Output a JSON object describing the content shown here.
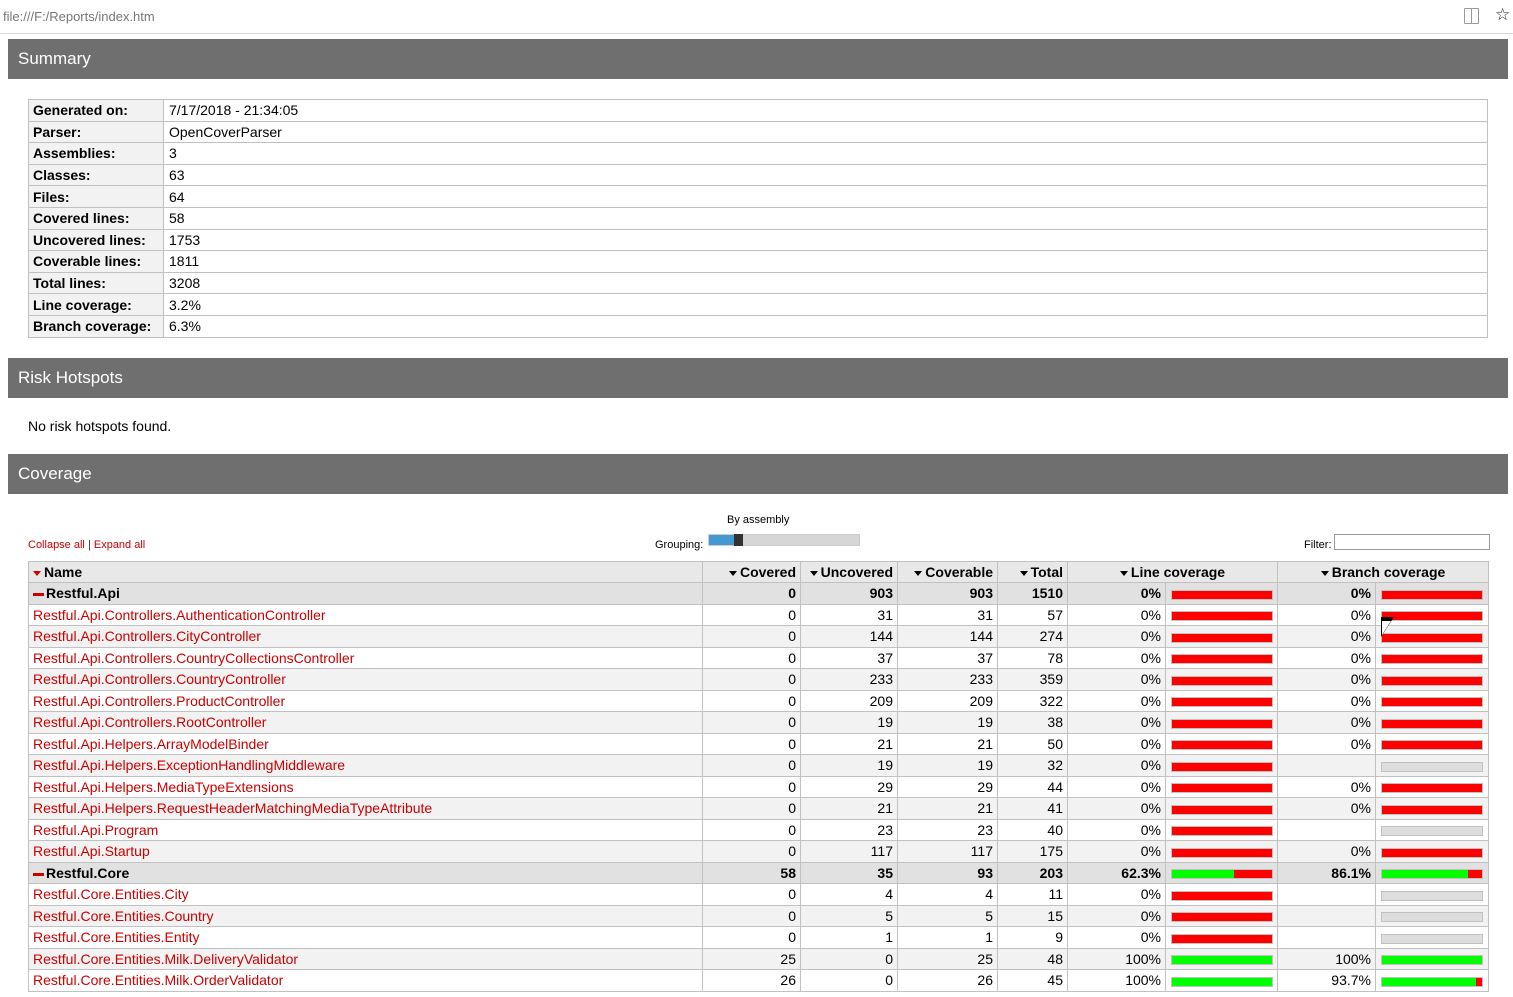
{
  "browser": {
    "url": "file:///F:/Reports/index.htm"
  },
  "summary": {
    "title": "Summary",
    "rows": [
      {
        "label": "Generated on:",
        "value": "7/17/2018 - 21:34:05"
      },
      {
        "label": "Parser:",
        "value": "OpenCoverParser"
      },
      {
        "label": "Assemblies:",
        "value": "3"
      },
      {
        "label": "Classes:",
        "value": "63"
      },
      {
        "label": "Files:",
        "value": "64"
      },
      {
        "label": "Covered lines:",
        "value": "58"
      },
      {
        "label": "Uncovered lines:",
        "value": "1753"
      },
      {
        "label": "Coverable lines:",
        "value": "1811"
      },
      {
        "label": "Total lines:",
        "value": "3208"
      },
      {
        "label": "Line coverage:",
        "value": "3.2%"
      },
      {
        "label": "Branch coverage:",
        "value": "6.3%"
      }
    ]
  },
  "risk": {
    "title": "Risk Hotspots",
    "message": "No risk hotspots found."
  },
  "coverage": {
    "title": "Coverage",
    "collapse_all": "Collapse all",
    "separator": "|",
    "expand_all": "Expand all",
    "grouping_label": "By assembly",
    "grouping_text": "Grouping:",
    "grouping_level": 0.2,
    "filter_label": "Filter:",
    "filter_value": "",
    "headers": {
      "name": "Name",
      "covered": "Covered",
      "uncovered": "Uncovered",
      "coverable": "Coverable",
      "total": "Total",
      "line_coverage": "Line coverage",
      "branch_coverage": "Branch coverage"
    },
    "colors": {
      "covered": "#00ff00",
      "uncovered": "#ff0000",
      "na": "#dddddd",
      "link": "#cc0000"
    },
    "rows": [
      {
        "type": "assembly",
        "name": "Restful.Api",
        "covered": "0",
        "uncovered": "903",
        "coverable": "903",
        "total": "1510",
        "line": "0%",
        "line_pct": 0,
        "branch": "0%",
        "branch_pct": 0
      },
      {
        "type": "class",
        "name": "Restful.Api.Controllers.AuthenticationController",
        "covered": "0",
        "uncovered": "31",
        "coverable": "31",
        "total": "57",
        "line": "0%",
        "line_pct": 0,
        "branch": "0%",
        "branch_pct": 0
      },
      {
        "type": "class",
        "name": "Restful.Api.Controllers.CityController",
        "covered": "0",
        "uncovered": "144",
        "coverable": "144",
        "total": "274",
        "line": "0%",
        "line_pct": 0,
        "branch": "0%",
        "branch_pct": 0
      },
      {
        "type": "class",
        "name": "Restful.Api.Controllers.CountryCollectionsController",
        "covered": "0",
        "uncovered": "37",
        "coverable": "37",
        "total": "78",
        "line": "0%",
        "line_pct": 0,
        "branch": "0%",
        "branch_pct": 0
      },
      {
        "type": "class",
        "name": "Restful.Api.Controllers.CountryController",
        "covered": "0",
        "uncovered": "233",
        "coverable": "233",
        "total": "359",
        "line": "0%",
        "line_pct": 0,
        "branch": "0%",
        "branch_pct": 0
      },
      {
        "type": "class",
        "name": "Restful.Api.Controllers.ProductController",
        "covered": "0",
        "uncovered": "209",
        "coverable": "209",
        "total": "322",
        "line": "0%",
        "line_pct": 0,
        "branch": "0%",
        "branch_pct": 0
      },
      {
        "type": "class",
        "name": "Restful.Api.Controllers.RootController",
        "covered": "0",
        "uncovered": "19",
        "coverable": "19",
        "total": "38",
        "line": "0%",
        "line_pct": 0,
        "branch": "0%",
        "branch_pct": 0
      },
      {
        "type": "class",
        "name": "Restful.Api.Helpers.ArrayModelBinder",
        "covered": "0",
        "uncovered": "21",
        "coverable": "21",
        "total": "50",
        "line": "0%",
        "line_pct": 0,
        "branch": "0%",
        "branch_pct": 0
      },
      {
        "type": "class",
        "name": "Restful.Api.Helpers.ExceptionHandlingMiddleware",
        "covered": "0",
        "uncovered": "19",
        "coverable": "19",
        "total": "32",
        "line": "0%",
        "line_pct": 0,
        "branch": "",
        "branch_pct": null
      },
      {
        "type": "class",
        "name": "Restful.Api.Helpers.MediaTypeExtensions",
        "covered": "0",
        "uncovered": "29",
        "coverable": "29",
        "total": "44",
        "line": "0%",
        "line_pct": 0,
        "branch": "0%",
        "branch_pct": 0
      },
      {
        "type": "class",
        "name": "Restful.Api.Helpers.RequestHeaderMatchingMediaTypeAttribute",
        "covered": "0",
        "uncovered": "21",
        "coverable": "21",
        "total": "41",
        "line": "0%",
        "line_pct": 0,
        "branch": "0%",
        "branch_pct": 0
      },
      {
        "type": "class",
        "name": "Restful.Api.Program",
        "covered": "0",
        "uncovered": "23",
        "coverable": "23",
        "total": "40",
        "line": "0%",
        "line_pct": 0,
        "branch": "",
        "branch_pct": null
      },
      {
        "type": "class",
        "name": "Restful.Api.Startup",
        "covered": "0",
        "uncovered": "117",
        "coverable": "117",
        "total": "175",
        "line": "0%",
        "line_pct": 0,
        "branch": "0%",
        "branch_pct": 0
      },
      {
        "type": "assembly",
        "name": "Restful.Core",
        "covered": "58",
        "uncovered": "35",
        "coverable": "93",
        "total": "203",
        "line": "62.3%",
        "line_pct": 62.3,
        "branch": "86.1%",
        "branch_pct": 86.1
      },
      {
        "type": "class",
        "name": "Restful.Core.Entities.City",
        "covered": "0",
        "uncovered": "4",
        "coverable": "4",
        "total": "11",
        "line": "0%",
        "line_pct": 0,
        "branch": "",
        "branch_pct": null
      },
      {
        "type": "class",
        "name": "Restful.Core.Entities.Country",
        "covered": "0",
        "uncovered": "5",
        "coverable": "5",
        "total": "15",
        "line": "0%",
        "line_pct": 0,
        "branch": "",
        "branch_pct": null
      },
      {
        "type": "class",
        "name": "Restful.Core.Entities.Entity",
        "covered": "0",
        "uncovered": "1",
        "coverable": "1",
        "total": "9",
        "line": "0%",
        "line_pct": 0,
        "branch": "",
        "branch_pct": null
      },
      {
        "type": "class",
        "name": "Restful.Core.Entities.Milk.DeliveryValidator",
        "covered": "25",
        "uncovered": "0",
        "coverable": "25",
        "total": "48",
        "line": "100%",
        "line_pct": 100,
        "branch": "100%",
        "branch_pct": 100
      },
      {
        "type": "class",
        "name": "Restful.Core.Entities.Milk.OrderValidator",
        "covered": "26",
        "uncovered": "0",
        "coverable": "26",
        "total": "45",
        "line": "100%",
        "line_pct": 100,
        "branch": "93.7%",
        "branch_pct": 93.7
      }
    ]
  }
}
